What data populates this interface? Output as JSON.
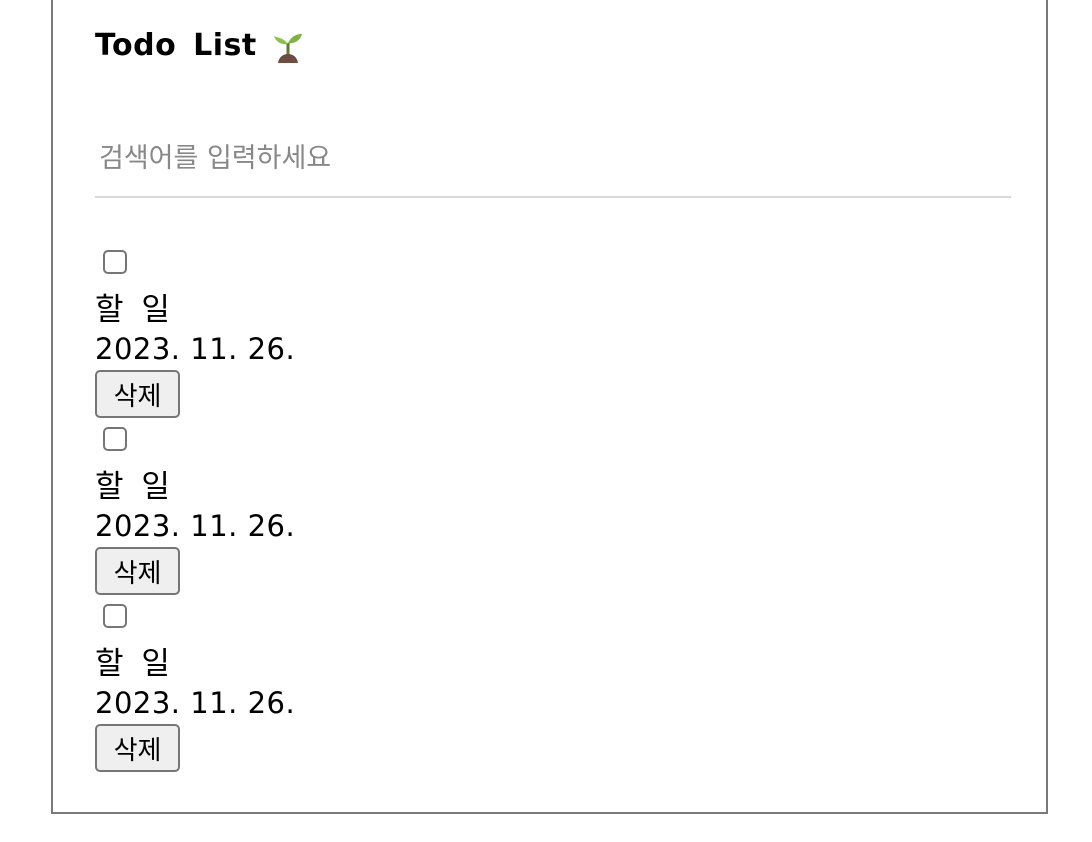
{
  "header": {
    "title": "Todo List"
  },
  "search": {
    "placeholder": "검색어를 입력하세요",
    "value": ""
  },
  "todos": [
    {
      "checked": false,
      "content": "할 일",
      "date": "2023. 11. 26.",
      "delete_label": "삭제"
    },
    {
      "checked": false,
      "content": "할 일",
      "date": "2023. 11. 26.",
      "delete_label": "삭제"
    },
    {
      "checked": false,
      "content": "할 일",
      "date": "2023. 11. 26.",
      "delete_label": "삭제"
    }
  ],
  "icons": {
    "title_icon": "seedling-icon"
  },
  "colors": {
    "panel_border": "#7a7a7a",
    "divider": "#d9d9d9",
    "button_bg": "#efefef",
    "leaf_green": "#8bc34a",
    "soil_brown": "#6d4c41"
  }
}
